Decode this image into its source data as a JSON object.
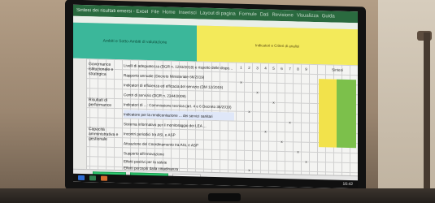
{
  "window": {
    "title": "Sintesi dei risultati emersi - Excel",
    "menu_items": [
      "File",
      "Home",
      "Inserisci",
      "Layout di pagina",
      "Formule",
      "Dati",
      "Revisione",
      "Visualizza",
      "Guida"
    ]
  },
  "header": {
    "left_title": "Ambiti e Sotto-Ambiti di valutazione",
    "right_title": "Indicatori e Criteri di analisi"
  },
  "sections": [
    "Governance istituzionale e strategica",
    "Risultati di performance",
    "Capacità amministrativa e gestionale"
  ],
  "rows": [
    "Livelli di adeguatezza (DGR n. 1243/2018) e rispetto delle disposizioni vigenti in materia",
    "Rapporto annuale (Decreto Ministeriale 66/2019)",
    "Indicatori di efficienza ed efficacia del servizio (DM 12/2019)",
    "Centri di servizio (DGR n. 2344/2009)",
    "Indicatori di ...: Commissione tecnica (art. 4 e 6 Decreto 38/2019)",
    "Indicatore per la rendicontazione ... dei servizi sanitari",
    "Sistema informativo per il monitoraggio dei LEA ...",
    "Incontri periodici tra ASL e ASP",
    "Attuazione del Coordinamento tra ASL e ASP",
    "Supporto all'innovazione",
    "Effetti positivi per la salute",
    "Effetti percepiti dalla cittadinanza",
    "Impatti ambientali"
  ],
  "right_pane": {
    "col_labels": [
      "1",
      "2",
      "3",
      "4",
      "5",
      "6",
      "7",
      "8",
      "9",
      "Sintesi"
    ],
    "sample_values": [
      "x",
      "x",
      "x",
      "x",
      "x",
      "x",
      "x",
      "x",
      "x",
      "x"
    ]
  },
  "sheet_tabs": {
    "nav_prev": "◀",
    "nav_next": "▶",
    "items": [
      "Tavola Sintesi",
      "Dettaglio risultati",
      "Note e fonti"
    ],
    "active_index": 0
  },
  "taskbar": {
    "time": "16:42"
  },
  "colors": {
    "excel_green": "#2a6a3f",
    "header_green": "#3bb79a",
    "header_yellow": "#f3ea5a",
    "sheet_tab_green": "#2ecc71"
  }
}
